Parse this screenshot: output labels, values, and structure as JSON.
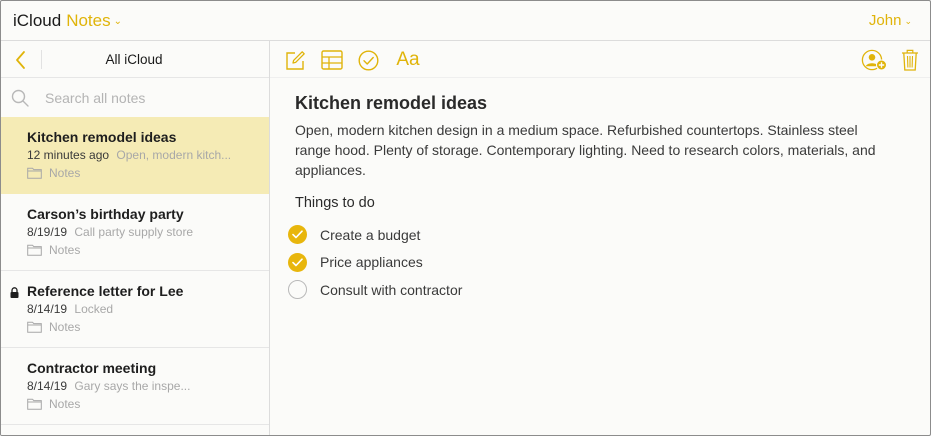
{
  "header": {
    "brand_primary": "iCloud",
    "brand_app": "Notes",
    "user_name": "John"
  },
  "sidebar": {
    "title": "All iCloud",
    "search_placeholder": "Search all notes",
    "notes": [
      {
        "title": "Kitchen remodel ideas",
        "date": "12 minutes ago",
        "preview": "Open, modern kitch...",
        "folder": "Notes",
        "selected": true,
        "locked": false
      },
      {
        "title": "Carson’s birthday party",
        "date": "8/19/19",
        "preview": "Call party supply store",
        "folder": "Notes",
        "selected": false,
        "locked": false
      },
      {
        "title": "Reference letter for Lee",
        "date": "8/14/19",
        "preview": "Locked",
        "folder": "Notes",
        "selected": false,
        "locked": true
      },
      {
        "title": "Contractor meeting",
        "date": "8/14/19",
        "preview": "Gary says the inspe...",
        "folder": "Notes",
        "selected": false,
        "locked": false
      }
    ]
  },
  "toolbar": {
    "format_label": "Aa"
  },
  "note": {
    "title": "Kitchen remodel ideas",
    "body": "Open, modern kitchen design in a medium space. Refurbished countertops. Stainless steel range hood. Plenty of storage. Contemporary lighting. Need to research colors, materials, and appliances.",
    "subheading": "Things to do",
    "checklist": [
      {
        "label": "Create a budget",
        "checked": true
      },
      {
        "label": "Price appliances",
        "checked": true
      },
      {
        "label": "Consult with contractor",
        "checked": false
      }
    ]
  },
  "colors": {
    "accent": "#e0b40a",
    "selected_row": "#f5ebb5",
    "check_fill": "#e8b60c"
  },
  "icons": [
    "chevron-left-icon",
    "search-icon",
    "folder-icon",
    "lock-icon",
    "compose-icon",
    "table-icon",
    "checklist-icon",
    "share-person-icon",
    "trash-icon"
  ]
}
